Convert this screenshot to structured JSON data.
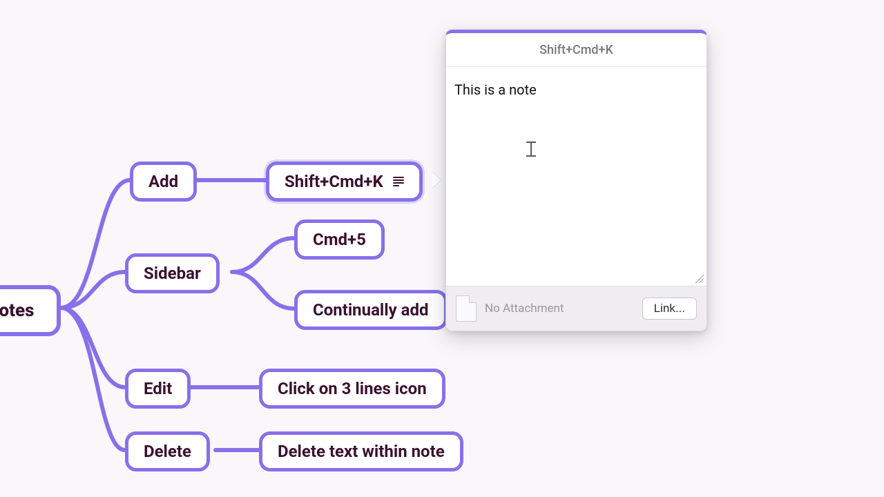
{
  "colors": {
    "accent": "#8770ea",
    "node_text": "#3a102e",
    "bg": "#f9f7fa",
    "footer_bg": "#efedef"
  },
  "mindmap": {
    "root": {
      "label": "otes"
    },
    "add": {
      "label": "Add",
      "children": {
        "shortcut": {
          "label": "Shift+Cmd+K",
          "has_note": true
        }
      }
    },
    "sidebar": {
      "label": "Sidebar",
      "children": {
        "shortcut": {
          "label": "Cmd+5"
        },
        "continually": {
          "label": "Continually add"
        }
      }
    },
    "edit": {
      "label": "Edit",
      "children": {
        "hint": {
          "label": "Click on 3 lines icon"
        }
      }
    },
    "delete": {
      "label": "Delete",
      "children": {
        "hint": {
          "label": "Delete text within note"
        }
      }
    }
  },
  "panel": {
    "title": "Shift+Cmd+K",
    "body_text": "This is a note",
    "attachment_placeholder": "No Attachment",
    "link_button": "Link..."
  }
}
